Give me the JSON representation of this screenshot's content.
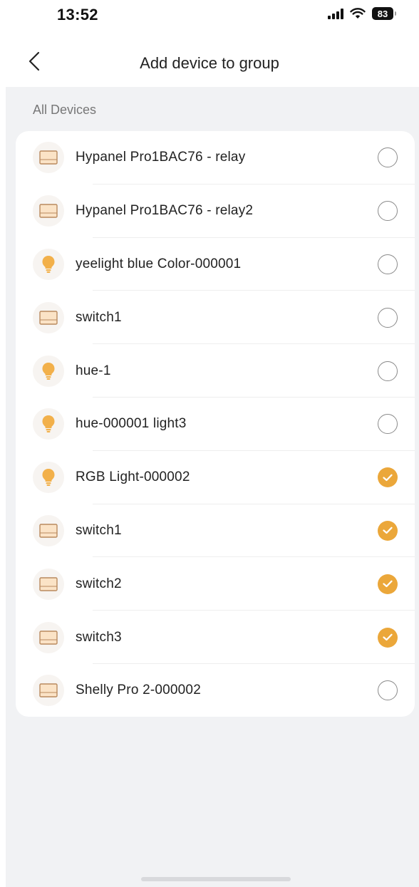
{
  "status_bar": {
    "time": "13:52",
    "battery": "83",
    "icons": [
      "signal-icon",
      "wifi-icon",
      "battery-icon"
    ]
  },
  "header": {
    "title": "Add device to group",
    "back_icon": "chevron-left-icon"
  },
  "section": {
    "label": "All Devices"
  },
  "colors": {
    "accent": "#eba73a",
    "background": "#f1f2f4",
    "card": "#ffffff"
  },
  "devices": [
    {
      "name": "Hypanel Pro1BAC76 - relay",
      "icon": "panel-icon",
      "selected": false
    },
    {
      "name": "Hypanel Pro1BAC76 - relay2",
      "icon": "panel-icon",
      "selected": false
    },
    {
      "name": "yeelight blue Color-000001",
      "icon": "bulb-icon",
      "selected": false
    },
    {
      "name": "switch1",
      "icon": "panel-icon",
      "selected": false
    },
    {
      "name": "hue-1",
      "icon": "bulb-icon",
      "selected": false
    },
    {
      "name": "hue-000001 light3",
      "icon": "bulb-icon",
      "selected": false
    },
    {
      "name": "RGB Light-000002",
      "icon": "bulb-icon",
      "selected": true
    },
    {
      "name": "switch1",
      "icon": "panel-icon",
      "selected": true
    },
    {
      "name": "switch2",
      "icon": "panel-icon",
      "selected": true
    },
    {
      "name": "switch3",
      "icon": "panel-icon",
      "selected": true
    },
    {
      "name": "Shelly Pro 2-000002",
      "icon": "panel-icon",
      "selected": false
    }
  ]
}
